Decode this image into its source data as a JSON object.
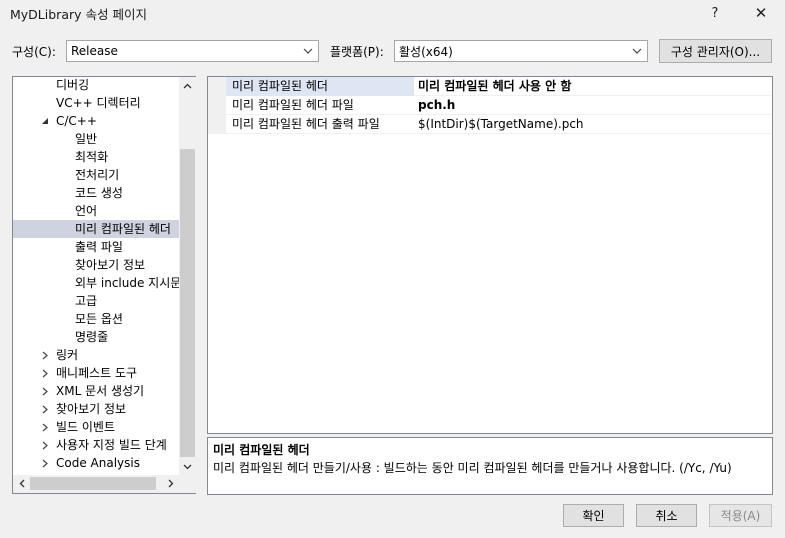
{
  "window": {
    "title": "MyDLibrary 속성 페이지",
    "help_label": "?",
    "close_label": "✕"
  },
  "toolbar": {
    "config_label": "구성(C):",
    "config_value": "Release",
    "platform_label": "플랫폼(P):",
    "platform_value": "활성(x64)",
    "config_manager_label": "구성 관리자(O)..."
  },
  "tree": {
    "items": [
      {
        "label": "디버깅",
        "indent": 2,
        "expander": ""
      },
      {
        "label": "VC++ 디렉터리",
        "indent": 2,
        "expander": ""
      },
      {
        "label": "C/C++",
        "indent": 2,
        "expander": "expanded"
      },
      {
        "label": "일반",
        "indent": 3,
        "expander": ""
      },
      {
        "label": "최적화",
        "indent": 3,
        "expander": ""
      },
      {
        "label": "전처리기",
        "indent": 3,
        "expander": ""
      },
      {
        "label": "코드 생성",
        "indent": 3,
        "expander": ""
      },
      {
        "label": "언어",
        "indent": 3,
        "expander": ""
      },
      {
        "label": "미리 컴파일된 헤더",
        "indent": 3,
        "expander": "",
        "selected": true
      },
      {
        "label": "출력 파일",
        "indent": 3,
        "expander": ""
      },
      {
        "label": "찾아보기 정보",
        "indent": 3,
        "expander": ""
      },
      {
        "label": "외부 include 지시문",
        "indent": 3,
        "expander": ""
      },
      {
        "label": "고급",
        "indent": 3,
        "expander": ""
      },
      {
        "label": "모든 옵션",
        "indent": 3,
        "expander": ""
      },
      {
        "label": "명령줄",
        "indent": 3,
        "expander": ""
      },
      {
        "label": "링커",
        "indent": 2,
        "expander": "collapsed"
      },
      {
        "label": "매니페스트 도구",
        "indent": 2,
        "expander": "collapsed"
      },
      {
        "label": "XML 문서 생성기",
        "indent": 2,
        "expander": "collapsed"
      },
      {
        "label": "찾아보기 정보",
        "indent": 2,
        "expander": "collapsed"
      },
      {
        "label": "빌드 이벤트",
        "indent": 2,
        "expander": "collapsed"
      },
      {
        "label": "사용자 지정 빌드 단계",
        "indent": 2,
        "expander": "collapsed"
      },
      {
        "label": "Code Analysis",
        "indent": 2,
        "expander": "collapsed"
      }
    ]
  },
  "properties": {
    "rows": [
      {
        "name": "미리 컴파일된 헤더",
        "value": "미리 컴파일된 헤더 사용 안 함",
        "bold": true,
        "selected": true
      },
      {
        "name": "미리 컴파일된 헤더 파일",
        "value": "pch.h",
        "bold": true,
        "selected": false
      },
      {
        "name": "미리 컴파일된 헤더 출력 파일",
        "value": "$(IntDir)$(TargetName).pch",
        "bold": false,
        "selected": false
      }
    ]
  },
  "description": {
    "title": "미리 컴파일된 헤더",
    "text": "미리 컴파일된 헤더 만들기/사용 : 빌드하는 동안 미리 컴파일된 헤더를 만들거나 사용합니다.     (/Yc, /Yu)"
  },
  "buttons": {
    "ok": "확인",
    "cancel": "취소",
    "apply": "적용(A)"
  }
}
